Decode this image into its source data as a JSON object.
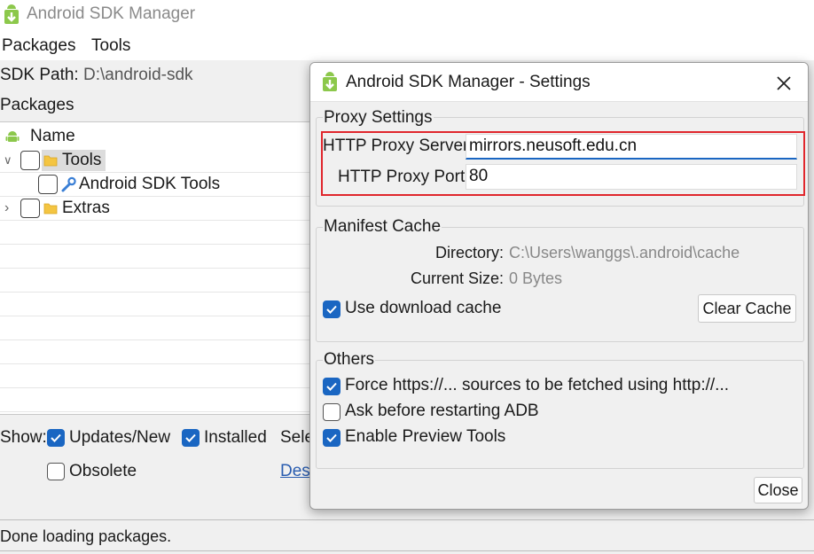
{
  "main": {
    "title": "Android SDK Manager",
    "menu": [
      "Packages",
      "Tools"
    ],
    "sdk_path_label": "SDK Path:",
    "sdk_path_value": "D:\\android-sdk",
    "packages_label": "Packages",
    "tree": {
      "header": "Name",
      "rows": [
        {
          "label": "Tools",
          "expander": "∨"
        },
        {
          "label": "Android SDK Tools"
        },
        {
          "label": "Extras",
          "expander": "›"
        }
      ]
    },
    "show": {
      "label": "Show:",
      "updates_new": "Updates/New",
      "installed": "Installed",
      "select_partial": "Sele",
      "obsolete": "Obsolete",
      "deselect_partial": "Des"
    },
    "status": "Done loading packages."
  },
  "dialog": {
    "title": "Android SDK Manager - Settings",
    "proxy": {
      "group_title": "Proxy Settings",
      "server_label": "HTTP Proxy Server",
      "server_value": "mirrors.neusoft.edu.cn",
      "port_label": "HTTP Proxy Port",
      "port_value": "80"
    },
    "cache": {
      "group_title": "Manifest Cache",
      "directory_label": "Directory:",
      "directory_value": "C:\\Users\\wanggs\\.android\\cache",
      "size_label": "Current Size:",
      "size_value": "0 Bytes",
      "use_cache_label": "Use download cache",
      "clear_button": "Clear Cache"
    },
    "others": {
      "group_title": "Others",
      "force_https": "Force https://... sources to be fetched using http://...",
      "ask_restart": "Ask before restarting ADB",
      "preview_tools": "Enable Preview Tools"
    },
    "close_button": "Close"
  },
  "colors": {
    "accent": "#1a66c2",
    "highlight_border": "#e0262c",
    "android_green": "#8cc84b",
    "folder": "#f4c542"
  },
  "icons": [
    "android-sdk-app-icon",
    "android-robot-icon",
    "folder-icon",
    "wrench-icon",
    "close-icon",
    "checkmark-icon"
  ]
}
